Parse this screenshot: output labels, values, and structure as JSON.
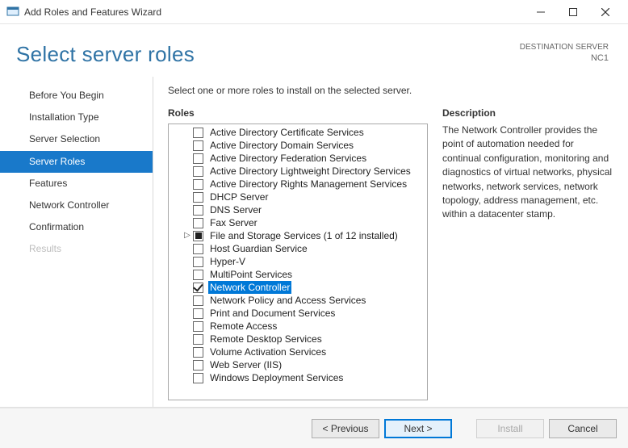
{
  "window": {
    "title": "Add Roles and Features Wizard"
  },
  "header": {
    "page_title": "Select server roles",
    "dest_label": "DESTINATION SERVER",
    "dest_name": "NC1"
  },
  "sidebar": {
    "items": [
      {
        "label": "Before You Begin",
        "state": "normal"
      },
      {
        "label": "Installation Type",
        "state": "normal"
      },
      {
        "label": "Server Selection",
        "state": "normal"
      },
      {
        "label": "Server Roles",
        "state": "active"
      },
      {
        "label": "Features",
        "state": "normal"
      },
      {
        "label": "Network Controller",
        "state": "normal"
      },
      {
        "label": "Confirmation",
        "state": "normal"
      },
      {
        "label": "Results",
        "state": "disabled"
      }
    ]
  },
  "content": {
    "instruction": "Select one or more roles to install on the selected server.",
    "roles_label": "Roles",
    "desc_label": "Description",
    "desc_text": "The Network Controller provides the point of automation needed for continual configuration, monitoring and diagnostics of virtual networks, physical networks, network services, network topology, address management, etc. within a datacenter stamp.",
    "roles": [
      {
        "label": "Active Directory Certificate Services",
        "check": "unchecked"
      },
      {
        "label": "Active Directory Domain Services",
        "check": "unchecked"
      },
      {
        "label": "Active Directory Federation Services",
        "check": "unchecked"
      },
      {
        "label": "Active Directory Lightweight Directory Services",
        "check": "unchecked"
      },
      {
        "label": "Active Directory Rights Management Services",
        "check": "unchecked"
      },
      {
        "label": "DHCP Server",
        "check": "unchecked"
      },
      {
        "label": "DNS Server",
        "check": "unchecked"
      },
      {
        "label": "Fax Server",
        "check": "unchecked"
      },
      {
        "label": "File and Storage Services (1 of 12 installed)",
        "check": "partial",
        "expandable": true
      },
      {
        "label": "Host Guardian Service",
        "check": "unchecked"
      },
      {
        "label": "Hyper-V",
        "check": "unchecked"
      },
      {
        "label": "MultiPoint Services",
        "check": "unchecked"
      },
      {
        "label": "Network Controller",
        "check": "checked",
        "selected": true
      },
      {
        "label": "Network Policy and Access Services",
        "check": "unchecked"
      },
      {
        "label": "Print and Document Services",
        "check": "unchecked"
      },
      {
        "label": "Remote Access",
        "check": "unchecked"
      },
      {
        "label": "Remote Desktop Services",
        "check": "unchecked"
      },
      {
        "label": "Volume Activation Services",
        "check": "unchecked"
      },
      {
        "label": "Web Server (IIS)",
        "check": "unchecked"
      },
      {
        "label": "Windows Deployment Services",
        "check": "unchecked"
      }
    ]
  },
  "buttons": {
    "previous": "< Previous",
    "next": "Next >",
    "install": "Install",
    "cancel": "Cancel"
  }
}
